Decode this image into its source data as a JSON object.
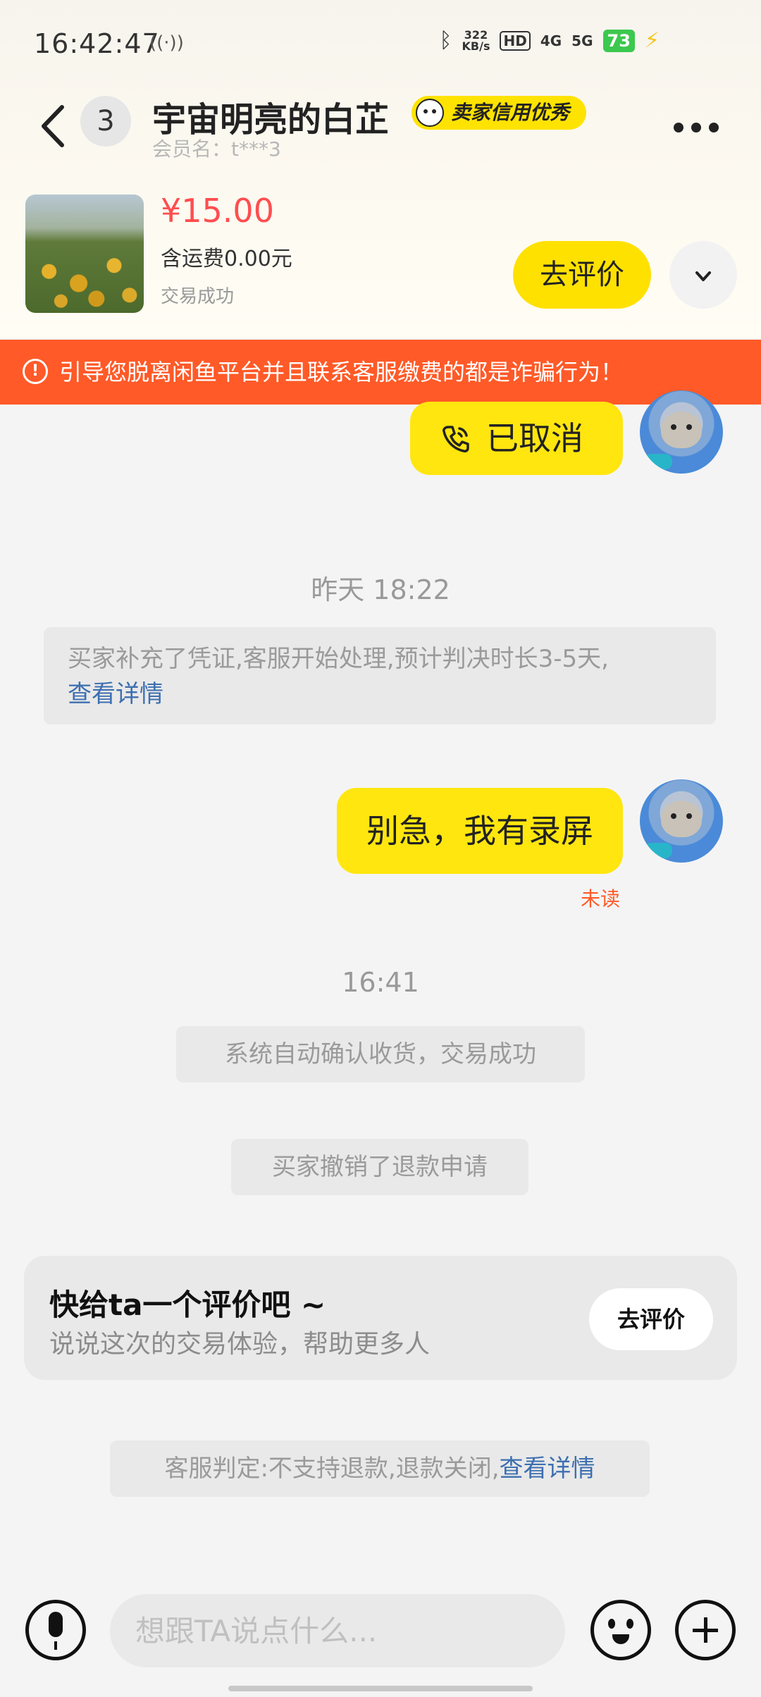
{
  "status_bar": {
    "time": "16:42:47",
    "net_speed_value": "322",
    "net_speed_unit": "KB/s",
    "hd": "HD",
    "sig1": "4G",
    "sig2": "5G",
    "battery": "73"
  },
  "header": {
    "unread_count": "3",
    "title": "宇宙明亮的白芷",
    "seller_badge": "卖家信用优秀",
    "member_name": "会员名：t***3"
  },
  "product": {
    "price": "¥15.00",
    "shipping": "含运费0.00元",
    "status": "交易成功",
    "review_button": "去评价"
  },
  "warning": {
    "text": "引导您脱离闲鱼平台并且联系客服缴费的都是诈骗行为！"
  },
  "chat": {
    "call_status": "已取消",
    "time_1": "昨天 18:22",
    "system_1_text": "买家补充了凭证,客服开始处理,预计判决时长3-5天,",
    "system_1_link": "查看详情",
    "my_message": "别急，我有录屏",
    "unread_label": "未读",
    "time_2": "16:41",
    "system_2": "系统自动确认收货，交易成功",
    "system_3": "买家撤销了退款申请",
    "rate_card": {
      "title": "快给ta一个评价吧 ~",
      "subtitle": "说说这次的交易体验，帮助更多人",
      "button": "去评价"
    },
    "system_4_text": "客服判定:不支持退款,退款关闭,",
    "system_4_link": "查看详情"
  },
  "input": {
    "placeholder": "想跟TA说点什么..."
  },
  "colors": {
    "accent_yellow": "#ffe100",
    "warning_orange": "#ff5a28",
    "price_red": "#ff4d4f",
    "link_blue": "#3d6fb0"
  }
}
